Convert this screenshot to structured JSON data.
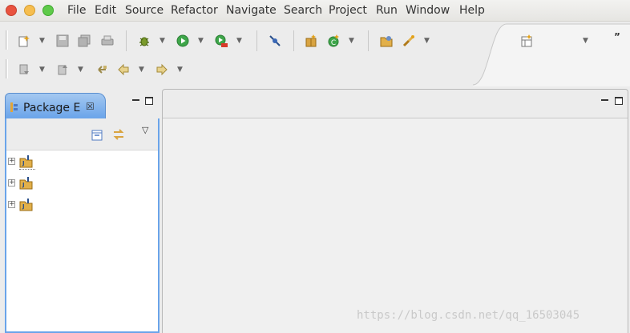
{
  "menubar": {
    "items": [
      "File",
      "Edit",
      "Source",
      "Refactor",
      "Navigate",
      "Search",
      "Project",
      "Run",
      "Window",
      "Help"
    ]
  },
  "toolbar": {
    "row1_icons": [
      "new-wizard-icon",
      "save-icon",
      "save-all-icon",
      "print-icon",
      "debug-icon",
      "run-icon",
      "coverage-run-icon",
      "toggle-breakpoint-icon",
      "new-java-package-icon",
      "new-java-class-icon",
      "open-type-icon",
      "search-icon"
    ],
    "row2_icons": [
      "next-annotation-icon",
      "previous-annotation-icon",
      "last-edit-location-icon",
      "back-icon",
      "forward-icon"
    ],
    "perspective_icon": "open-perspective-icon",
    "overflow_label": "”"
  },
  "package_explorer": {
    "tab_label": "Package E",
    "tab_close": "☒",
    "view_menu": "▽",
    "projects": [
      {
        "expand": "+",
        "icon": "java-project-icon"
      },
      {
        "expand": "+",
        "icon": "java-project-icon"
      },
      {
        "expand": "+",
        "icon": "java-project-icon"
      }
    ]
  },
  "watermark": "https://blog.csdn.net/qq_16503045",
  "colors": {
    "tab_active": "#6aa4ea",
    "menubar_bg": "#e9e8e5",
    "close": "#e9533f",
    "minimize": "#f6be4f",
    "maximize": "#5fca4a"
  }
}
